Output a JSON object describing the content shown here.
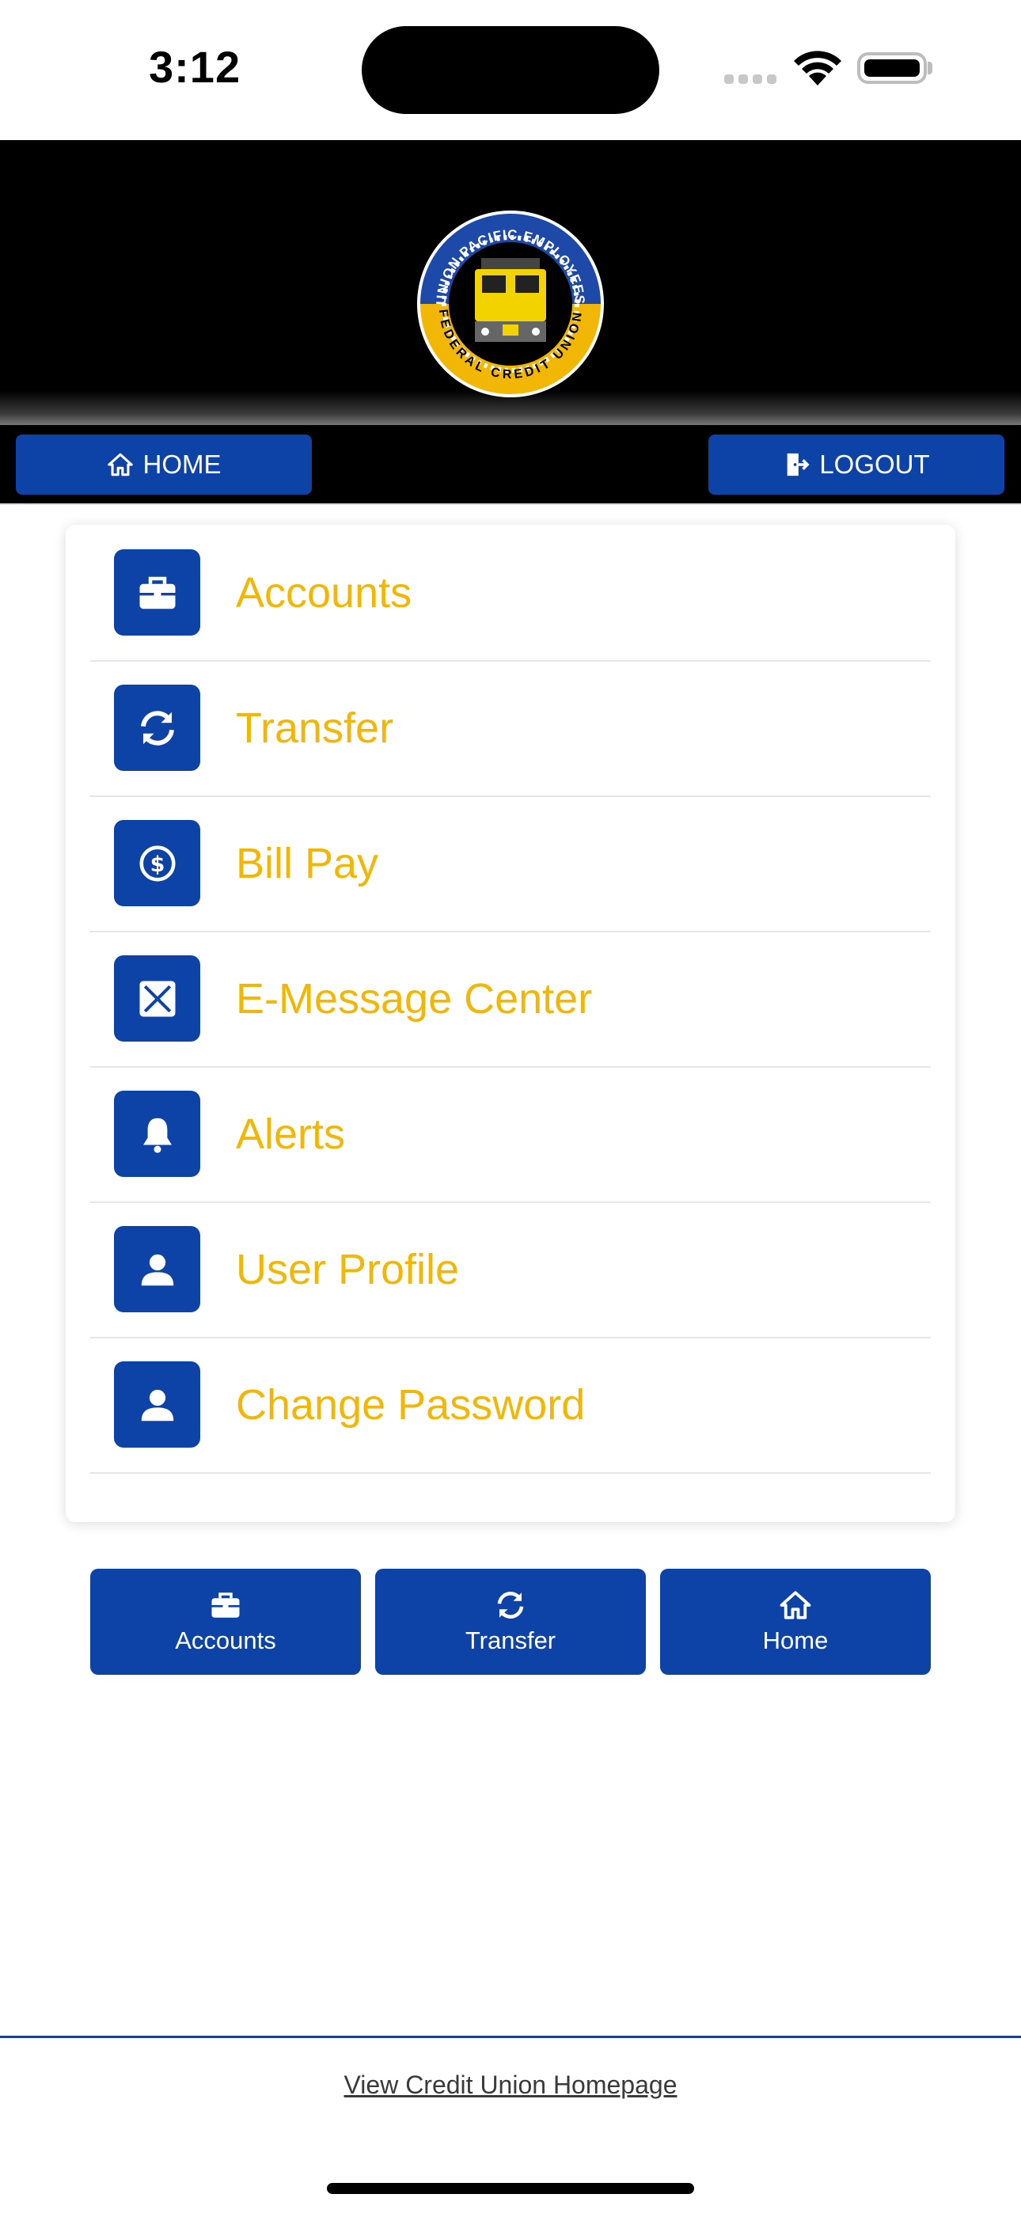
{
  "status_bar": {
    "time": "3:12"
  },
  "header": {
    "logo_text_top": "UNION PACIFIC EMPLOYEES",
    "logo_text_bottom": "FEDERAL CREDIT UNION"
  },
  "nav": {
    "home_label": "HOME",
    "logout_label": "LOGOUT"
  },
  "menu": {
    "items": [
      {
        "label": "Accounts",
        "icon": "briefcase-icon"
      },
      {
        "label": "Transfer",
        "icon": "refresh-icon"
      },
      {
        "label": "Bill Pay",
        "icon": "dollar-circle-icon"
      },
      {
        "label": "E-Message Center",
        "icon": "envelope-icon"
      },
      {
        "label": "Alerts",
        "icon": "bell-icon"
      },
      {
        "label": "User Profile",
        "icon": "user-icon"
      },
      {
        "label": "Change Password",
        "icon": "user-icon"
      }
    ]
  },
  "quick": {
    "items": [
      {
        "label": "Accounts",
        "icon": "briefcase-icon"
      },
      {
        "label": "Transfer",
        "icon": "refresh-icon"
      },
      {
        "label": "Home",
        "icon": "home-icon"
      }
    ]
  },
  "footer": {
    "link_label": "View Credit Union Homepage"
  },
  "colors": {
    "brand_blue": "#0d43a6",
    "menu_text": "#f2b705",
    "header_bg": "#000000"
  }
}
